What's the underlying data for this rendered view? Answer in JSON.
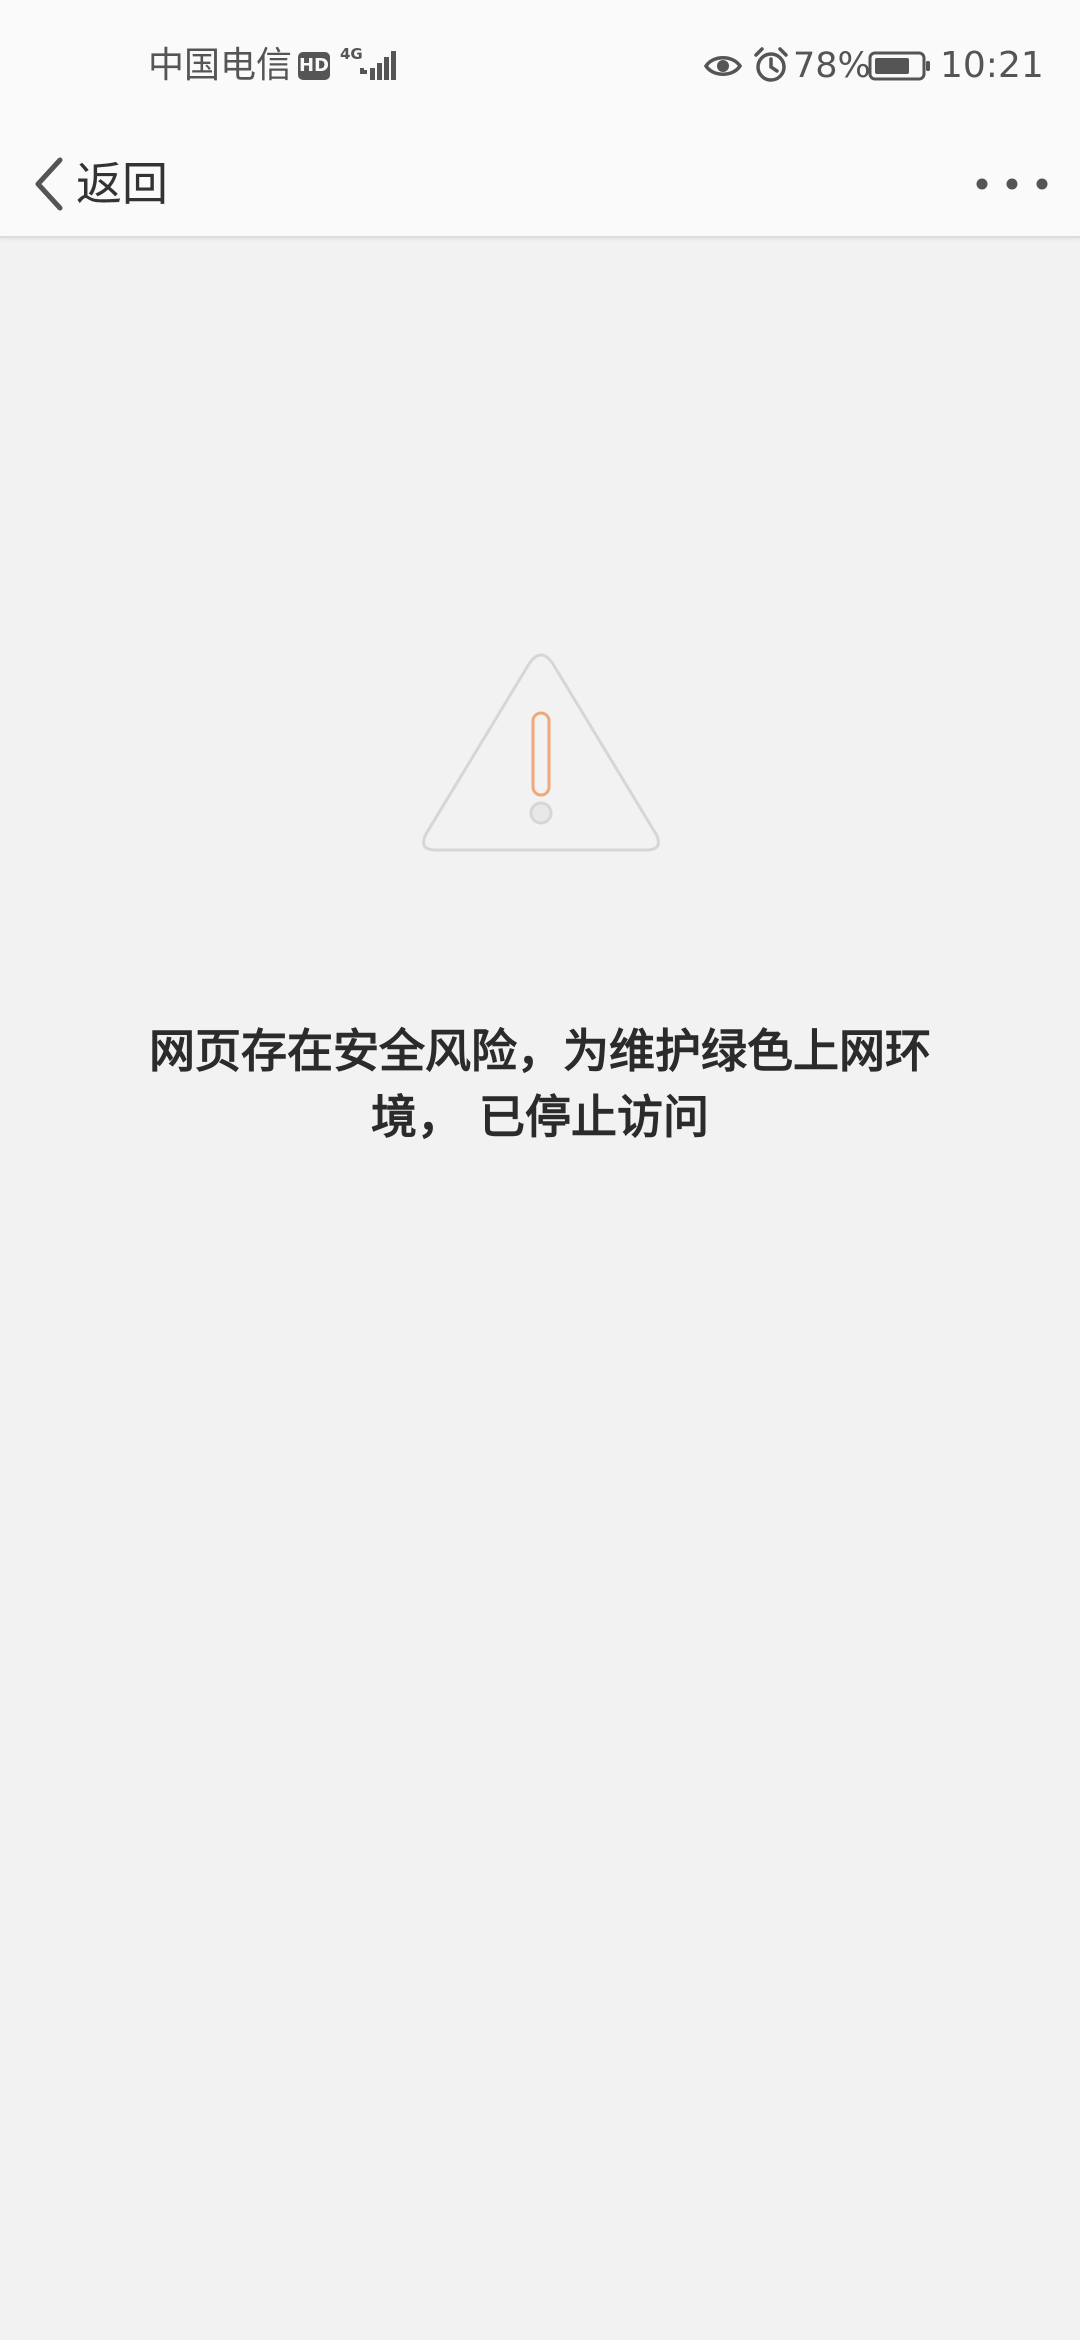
{
  "status_bar": {
    "carrier": "中国电信",
    "hd_badge": "HD",
    "network_type": "4G",
    "battery_percent": "78%",
    "time": "10:21",
    "icons": [
      "eye-icon",
      "alarm-icon",
      "battery-icon",
      "signal-icon"
    ]
  },
  "nav": {
    "back_label": "返回",
    "icons": [
      "chevron-left-icon",
      "more-icon"
    ]
  },
  "main": {
    "icon": "warning-triangle-icon",
    "message_line1": "网页存在安全风险，为维护绿色上网环",
    "message_line2": "境， 已停止访问"
  },
  "colors": {
    "background": "#f2f2f2",
    "bar": "#fafafa",
    "warning_accent": "#f0a878",
    "triangle_stroke": "#d6d6d6"
  }
}
